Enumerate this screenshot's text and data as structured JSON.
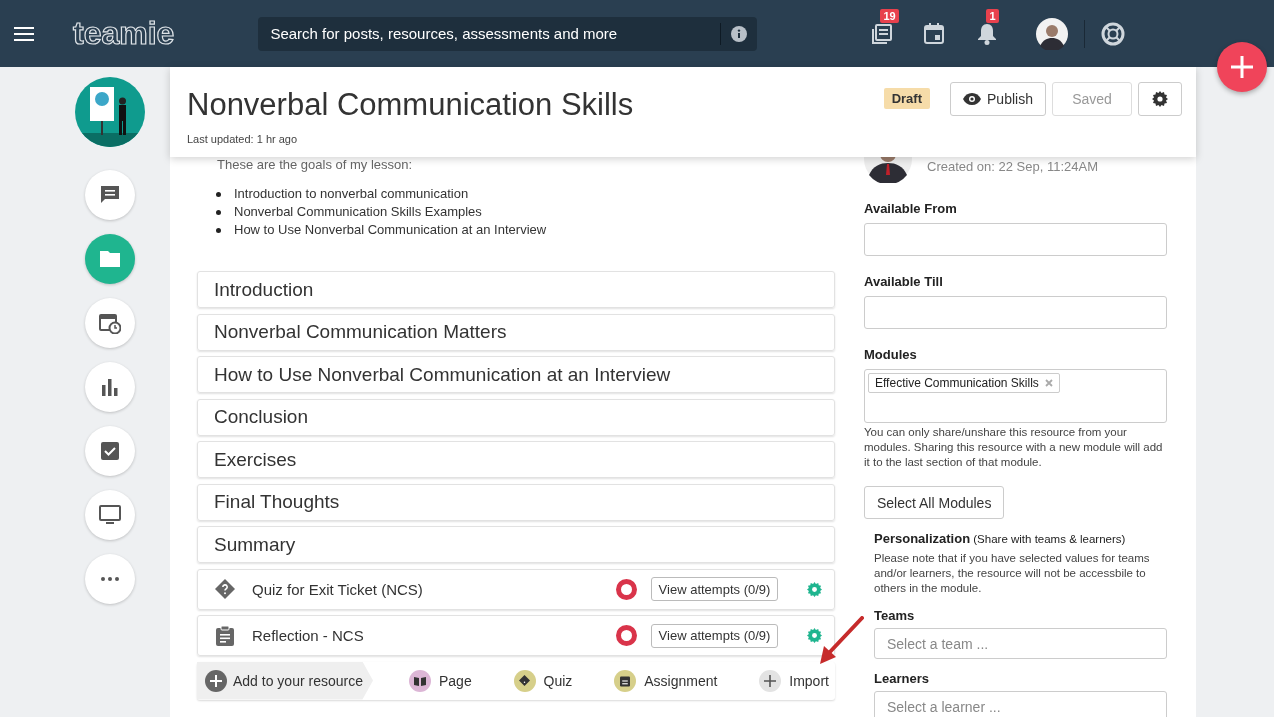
{
  "topbar": {
    "logo": "teamie",
    "search": {
      "placeholder": "Search for posts, resources, assessments and more"
    },
    "badges": [
      "19",
      "1"
    ]
  },
  "sidebar": {
    "items": [
      {
        "selected": false
      },
      {
        "selected": true
      },
      {
        "selected": false
      },
      {
        "selected": false
      },
      {
        "selected": false
      },
      {
        "selected": false
      },
      {
        "selected": false
      }
    ]
  },
  "header": {
    "title": "Nonverbal Communication Skills",
    "last_updated": "Last updated: 1 hr ago",
    "status": "Draft",
    "publish": "Publish",
    "saved": {
      "label": "Saved",
      "disabled": true
    }
  },
  "goals": {
    "intro": "These are the goals of my lesson:",
    "items": [
      "Introduction to nonverbal communication",
      "Nonverbal Communication Skills Examples",
      "How to Use Nonverbal Communication at an Interview"
    ]
  },
  "sections": [
    "Introduction",
    "Nonverbal Communication Matters",
    "How to Use Nonverbal Communication at an Interview",
    "Conclusion",
    "Exercises",
    "Final Thoughts",
    "Summary"
  ],
  "activities": [
    {
      "kind": "quiz",
      "title": "Quiz for Exit Ticket (NCS)",
      "attempts": "View attempts (0/9)"
    },
    {
      "kind": "assignment",
      "title": "Reflection - NCS",
      "attempts": "View attempts (0/9)"
    }
  ],
  "add_bar": {
    "label": "Add to your resource",
    "options": [
      {
        "kind": "page",
        "label": "Page"
      },
      {
        "kind": "quiz",
        "label": "Quiz"
      },
      {
        "kind": "assignment",
        "label": "Assignment"
      },
      {
        "kind": "import",
        "label": "Import"
      }
    ]
  },
  "details": {
    "created": "Created on: 22 Sep, 11:24AM",
    "available_from": "Available From",
    "available_till": "Available Till",
    "modules_label": "Modules",
    "modules": [
      "Effective Communication Skills"
    ],
    "modules_note": "You can only share/unshare this resource from your modules. Sharing this resource with a new module will add it to the last section of that module.",
    "select_all": "Select All Modules",
    "personalization": "**Personalization** (Share with teams & learners)",
    "personalization_note": "Please note that if you have selected values for teams and/or learners, the resource will not be accessbile to others in the module.",
    "teams_label": "Teams",
    "teams_placeholder": "Select a team ...",
    "learners_label": "Learners",
    "learners_placeholder": "Select a learner ..."
  }
}
